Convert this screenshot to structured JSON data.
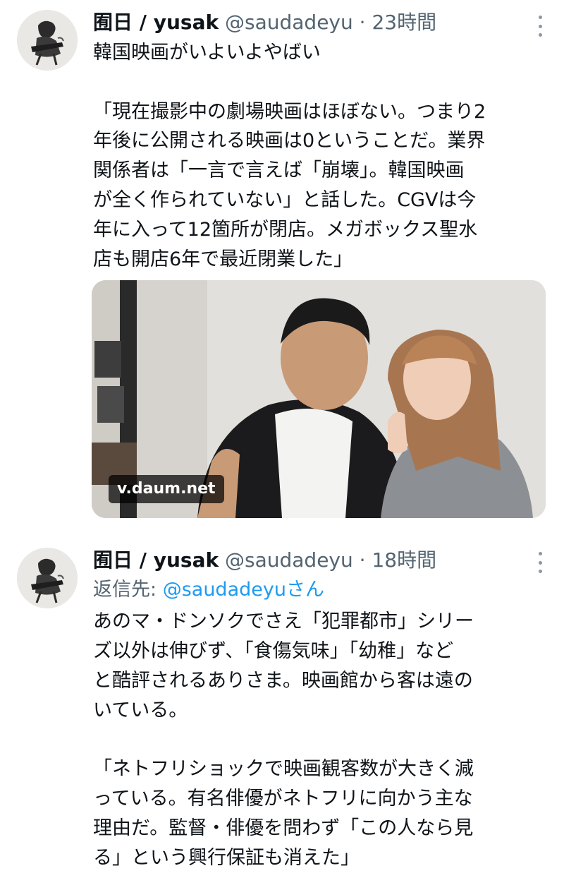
{
  "tweets": [
    {
      "display_name": "囿日 / yusak",
      "handle": "@saudadeyu",
      "separator": "·",
      "time": "23時間",
      "lines": [
        "韓国映画がいよいよやばい",
        "「現在撮影中の劇場映画はほぼない。つまり2",
        "年後に公開される映画は0ということだ。業界",
        "関係者は「一言で言えば「崩壊」。韓国映画",
        "が全く作られていない」と話した。CGVは今",
        "年に入って12箇所が閉店。メガボックス聖水",
        "店も開店6年で最近閉業した」"
      ],
      "link_card": {
        "domain": "v.daum.net"
      }
    },
    {
      "display_name": "囿日 / yusak",
      "handle": "@saudadeyu",
      "separator": "·",
      "time": "18時間",
      "reply_prefix": "返信先:",
      "reply_handle": "@saudadeyuさん",
      "lines": [
        "あのマ・ドンソクでさえ「犯罪都市」シリー",
        "ズ以外は伸びず、「食傷気味」「幼稚」など",
        "と酷評されるありさま。映画館から客は遠の",
        "いている。",
        "「ネトフリショックで映画観客数が大きく減",
        "っている。有名俳優がネトフリに向かう主な",
        "理由だ。監督・俳優を問わず「この人なら見",
        "る」という興行保証も消えた」"
      ]
    }
  ],
  "icons": {
    "more": "more-dots-icon",
    "avatar": "avatar-guitarist-sketch"
  },
  "colors": {
    "text": "#0f1419",
    "secondary": "#536471",
    "link": "#1d9bf0"
  }
}
